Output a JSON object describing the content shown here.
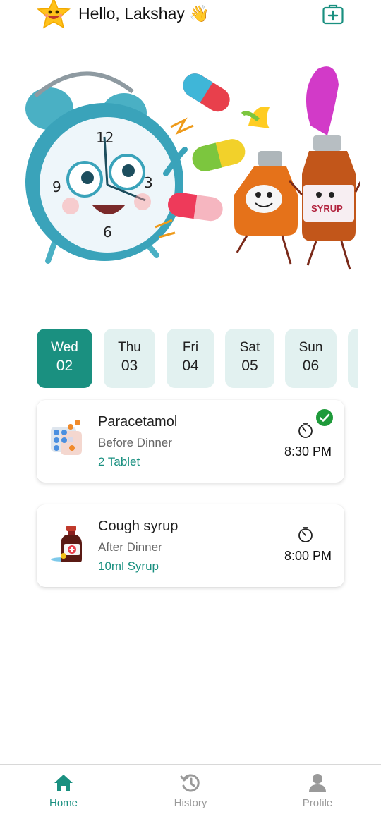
{
  "header": {
    "greeting": "Hello, Lakshay 👋",
    "avatar_icon": "smiling-star-icon",
    "add_icon": "medical-kit-plus-icon"
  },
  "hero": {
    "syrup_label": "SYRUP",
    "clock_numbers": [
      "12",
      "3",
      "6",
      "9"
    ]
  },
  "days": [
    {
      "name": "Wed",
      "num": "02",
      "active": true
    },
    {
      "name": "Thu",
      "num": "03",
      "active": false
    },
    {
      "name": "Fri",
      "num": "04",
      "active": false
    },
    {
      "name": "Sat",
      "num": "05",
      "active": false
    },
    {
      "name": "Sun",
      "num": "06",
      "active": false
    }
  ],
  "medicines": [
    {
      "name": "Paracetamol",
      "when": "Before Dinner",
      "dose": "2 Tablet",
      "time": "8:30 PM",
      "taken": true,
      "icon": "tablet-blister-icon"
    },
    {
      "name": "Cough syrup",
      "when": "After Dinner",
      "dose": "10ml Syrup",
      "time": "8:00 PM",
      "taken": false,
      "icon": "syrup-bottle-icon"
    }
  ],
  "nav": [
    {
      "label": "Home",
      "icon": "home-icon",
      "active": true
    },
    {
      "label": "History",
      "icon": "history-icon",
      "active": false
    },
    {
      "label": "Profile",
      "icon": "profile-icon",
      "active": false
    }
  ],
  "colors": {
    "accent": "#1a9080",
    "day_bg": "#e2f1f0",
    "check_green": "#1e9a3a",
    "inactive_nav": "#9a9a9a"
  }
}
